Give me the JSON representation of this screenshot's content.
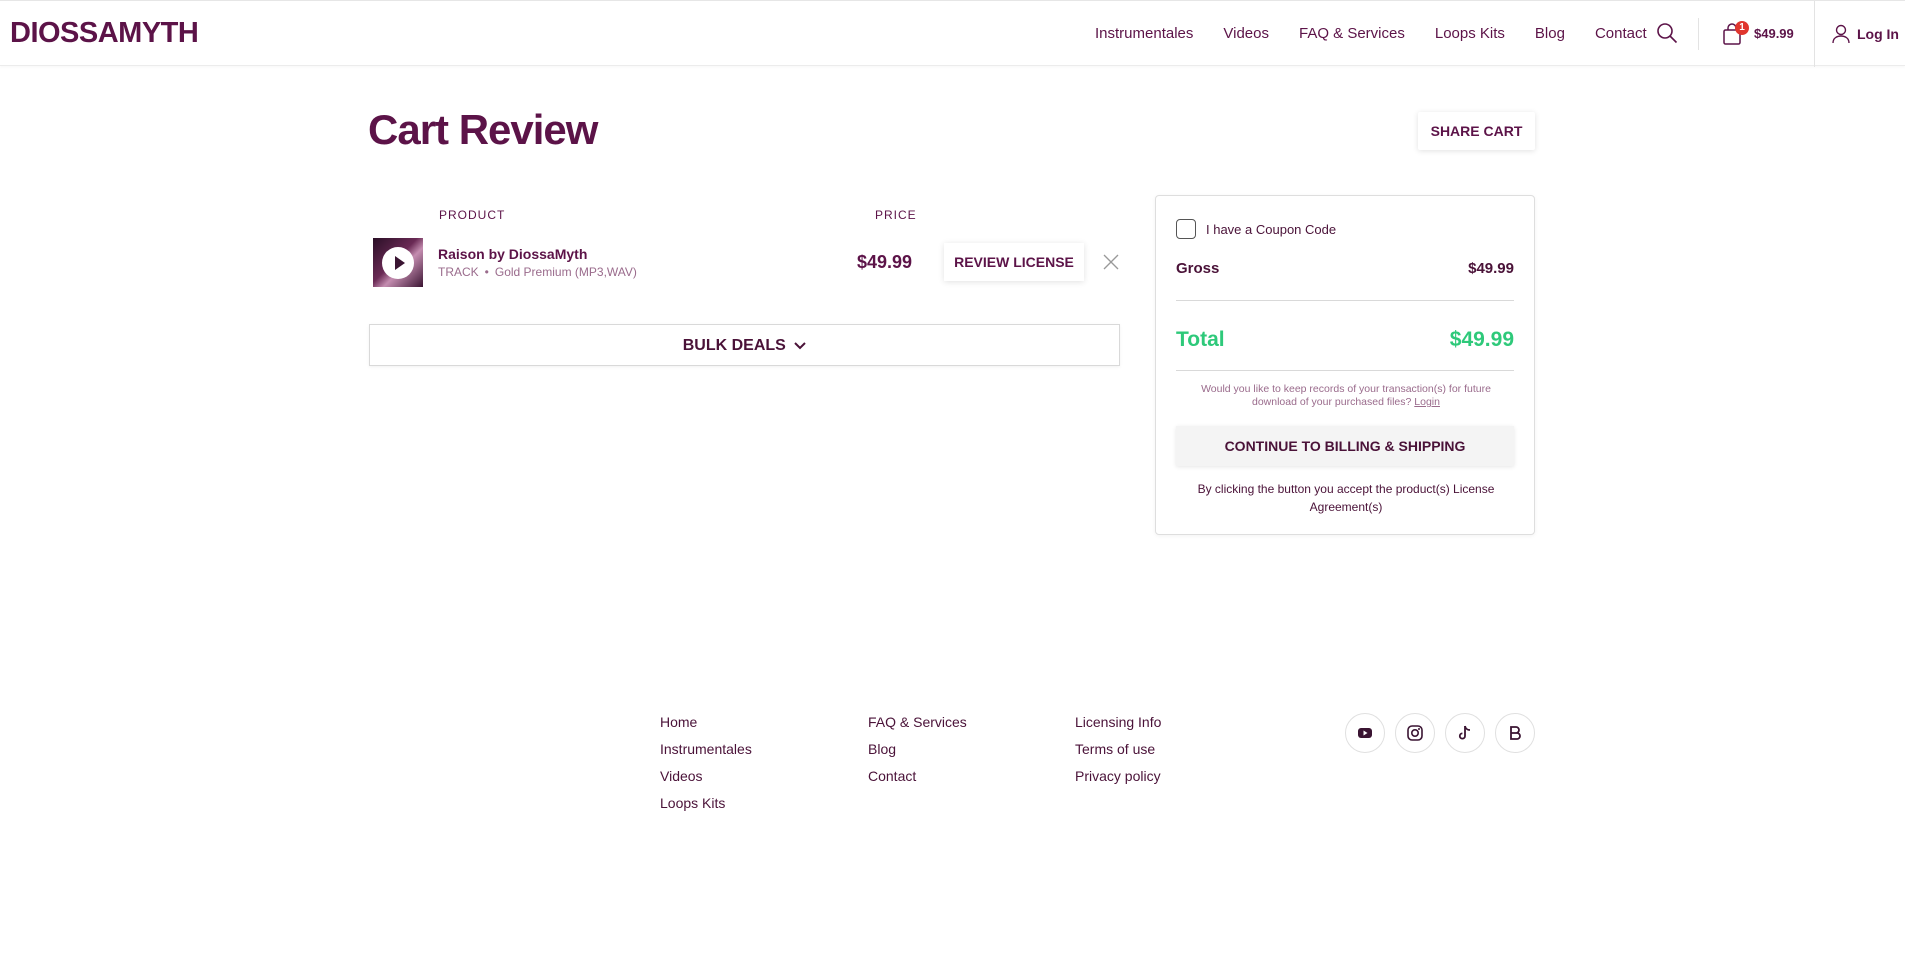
{
  "header": {
    "logo": "DIOSSAMYTH",
    "nav": [
      "Instrumentales",
      "Videos",
      "FAQ & Services",
      "Loops Kits",
      "Blog",
      "Contact"
    ],
    "cart_count": "1",
    "cart_total": "$49.99",
    "login_label": "Log In"
  },
  "main": {
    "title": "Cart Review",
    "share_label": "SHARE CART",
    "col_product": "PRODUCT",
    "col_price": "PRICE",
    "item": {
      "name": "Raison by DiossaMyth",
      "type": "TRACK",
      "dot": "•",
      "license": "Gold Premium (MP3,WAV)",
      "price": "$49.99",
      "review_label": "REVIEW LICENSE"
    },
    "bulk_label": "BULK DEALS"
  },
  "summary": {
    "coupon_label": "I have a Coupon Code",
    "gross_label": "Gross",
    "gross_value": "$49.99",
    "total_label": "Total",
    "total_value": "$49.99",
    "records_note": "Would you like to keep records of your transaction(s) for future download of your purchased files?",
    "login_link": "Login",
    "continue_label": "CONTINUE TO BILLING & SHIPPING",
    "accept_note": "By clicking the button you accept the product(s) License Agreement(s)"
  },
  "footer": {
    "col1": [
      "Home",
      "Instrumentales",
      "Videos",
      "Loops Kits"
    ],
    "col2": [
      "FAQ & Services",
      "Blog",
      "Contact"
    ],
    "col3": [
      "Licensing Info",
      "Terms of use",
      "Privacy policy"
    ],
    "social": [
      "youtube-icon",
      "instagram-icon",
      "tiktok-icon",
      "beatstars-icon"
    ]
  },
  "colors": {
    "brand": "#5c1348",
    "total": "#2ec97a",
    "badge": "#e0362e"
  }
}
